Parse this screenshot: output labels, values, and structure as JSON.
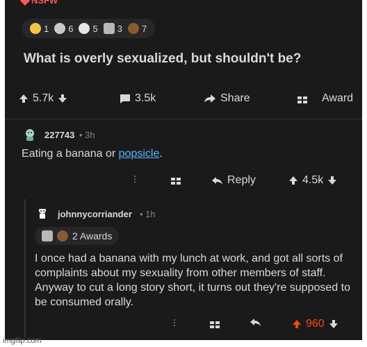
{
  "post": {
    "nsfw_label": "NSFW",
    "awards": [
      {
        "icon": "gold-trophy-icon",
        "count": "1",
        "color": "#f4c542"
      },
      {
        "icon": "wholesome-award-icon",
        "count": "6",
        "color": "#c9c9c9"
      },
      {
        "icon": "laughing-award-icon",
        "count": "5",
        "color": "#e6e6e6"
      },
      {
        "icon": "silver-award-icon",
        "count": "3",
        "color": "#b8b8b8"
      },
      {
        "icon": "poop-award-icon",
        "count": "7",
        "color": "#8b5a2b"
      }
    ],
    "title": "What is overly sexualized, but shouldn't be?",
    "upvotes": "5.7k",
    "comments": "3.5k",
    "share_label": "Share",
    "award_label": "Award"
  },
  "comment1": {
    "username": "227743",
    "time": "3h",
    "body_prefix": "Eating a banana or ",
    "body_link": "popsicle",
    "body_suffix": ".",
    "reply_label": "Reply",
    "score": "4.5k"
  },
  "comment2": {
    "username": "johnnycorriander",
    "time": "1h",
    "awards_label": "2 Awards",
    "body": "I once had a banana with my lunch at work, and got all sorts of complaints about my sexuality from other members of staff. Anyway to cut a long story short, it turns out they're supposed to be consumed orally.",
    "score": "960",
    "score_color": "#ff4500"
  },
  "watermark": "imgflip.com"
}
